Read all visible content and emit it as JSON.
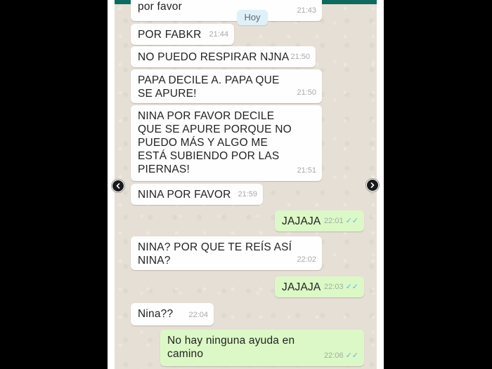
{
  "chat": {
    "date_chip": "Hoy",
    "messages": [
      {
        "text": "por favor",
        "time": "21:43",
        "dir": "in"
      },
      {
        "text": "POR FABKR",
        "time": "21:44",
        "dir": "in"
      },
      {
        "text": "NO PUEDO RESPIRAR NJNA",
        "time": "21:50",
        "dir": "in"
      },
      {
        "text": "PAPA DECILE A. PAPA QUE\nSE APURE!",
        "time": "21:50",
        "dir": "in"
      },
      {
        "text": "NINA POR FAVOR DECILE\nQUE SE APURE PORQUE NO\nPUEDO MÁS Y ALGO ME\nESTÁ SUBIENDO POR LAS\nPIERNAS!",
        "time": "21:51",
        "dir": "in"
      },
      {
        "text": "NINA POR FAVOR",
        "time": "21:59",
        "dir": "in"
      },
      {
        "text": "JAJAJA",
        "time": "22:01",
        "dir": "out"
      },
      {
        "text": "NINA? POR QUE TE REÍS ASÍ\nNINA?",
        "time": "22:02",
        "dir": "in"
      },
      {
        "text": "JAJAJA",
        "time": "22:03",
        "dir": "out"
      },
      {
        "text": "Nina??",
        "time": "22:04",
        "dir": "in"
      },
      {
        "text": "No hay ninguna ayuda en\ncamino",
        "time": "22:06",
        "dir": "out"
      }
    ]
  },
  "viewer": {
    "prev_icon": "chevron-left-icon",
    "next_icon": "chevron-right-icon"
  },
  "colors": {
    "incoming_bubble": "#fefefe",
    "outgoing_bubble": "#dcf8c6",
    "chat_background": "#e6dfd5",
    "read_ticks": "#5ab8e6",
    "header": "#0b6b5e"
  }
}
